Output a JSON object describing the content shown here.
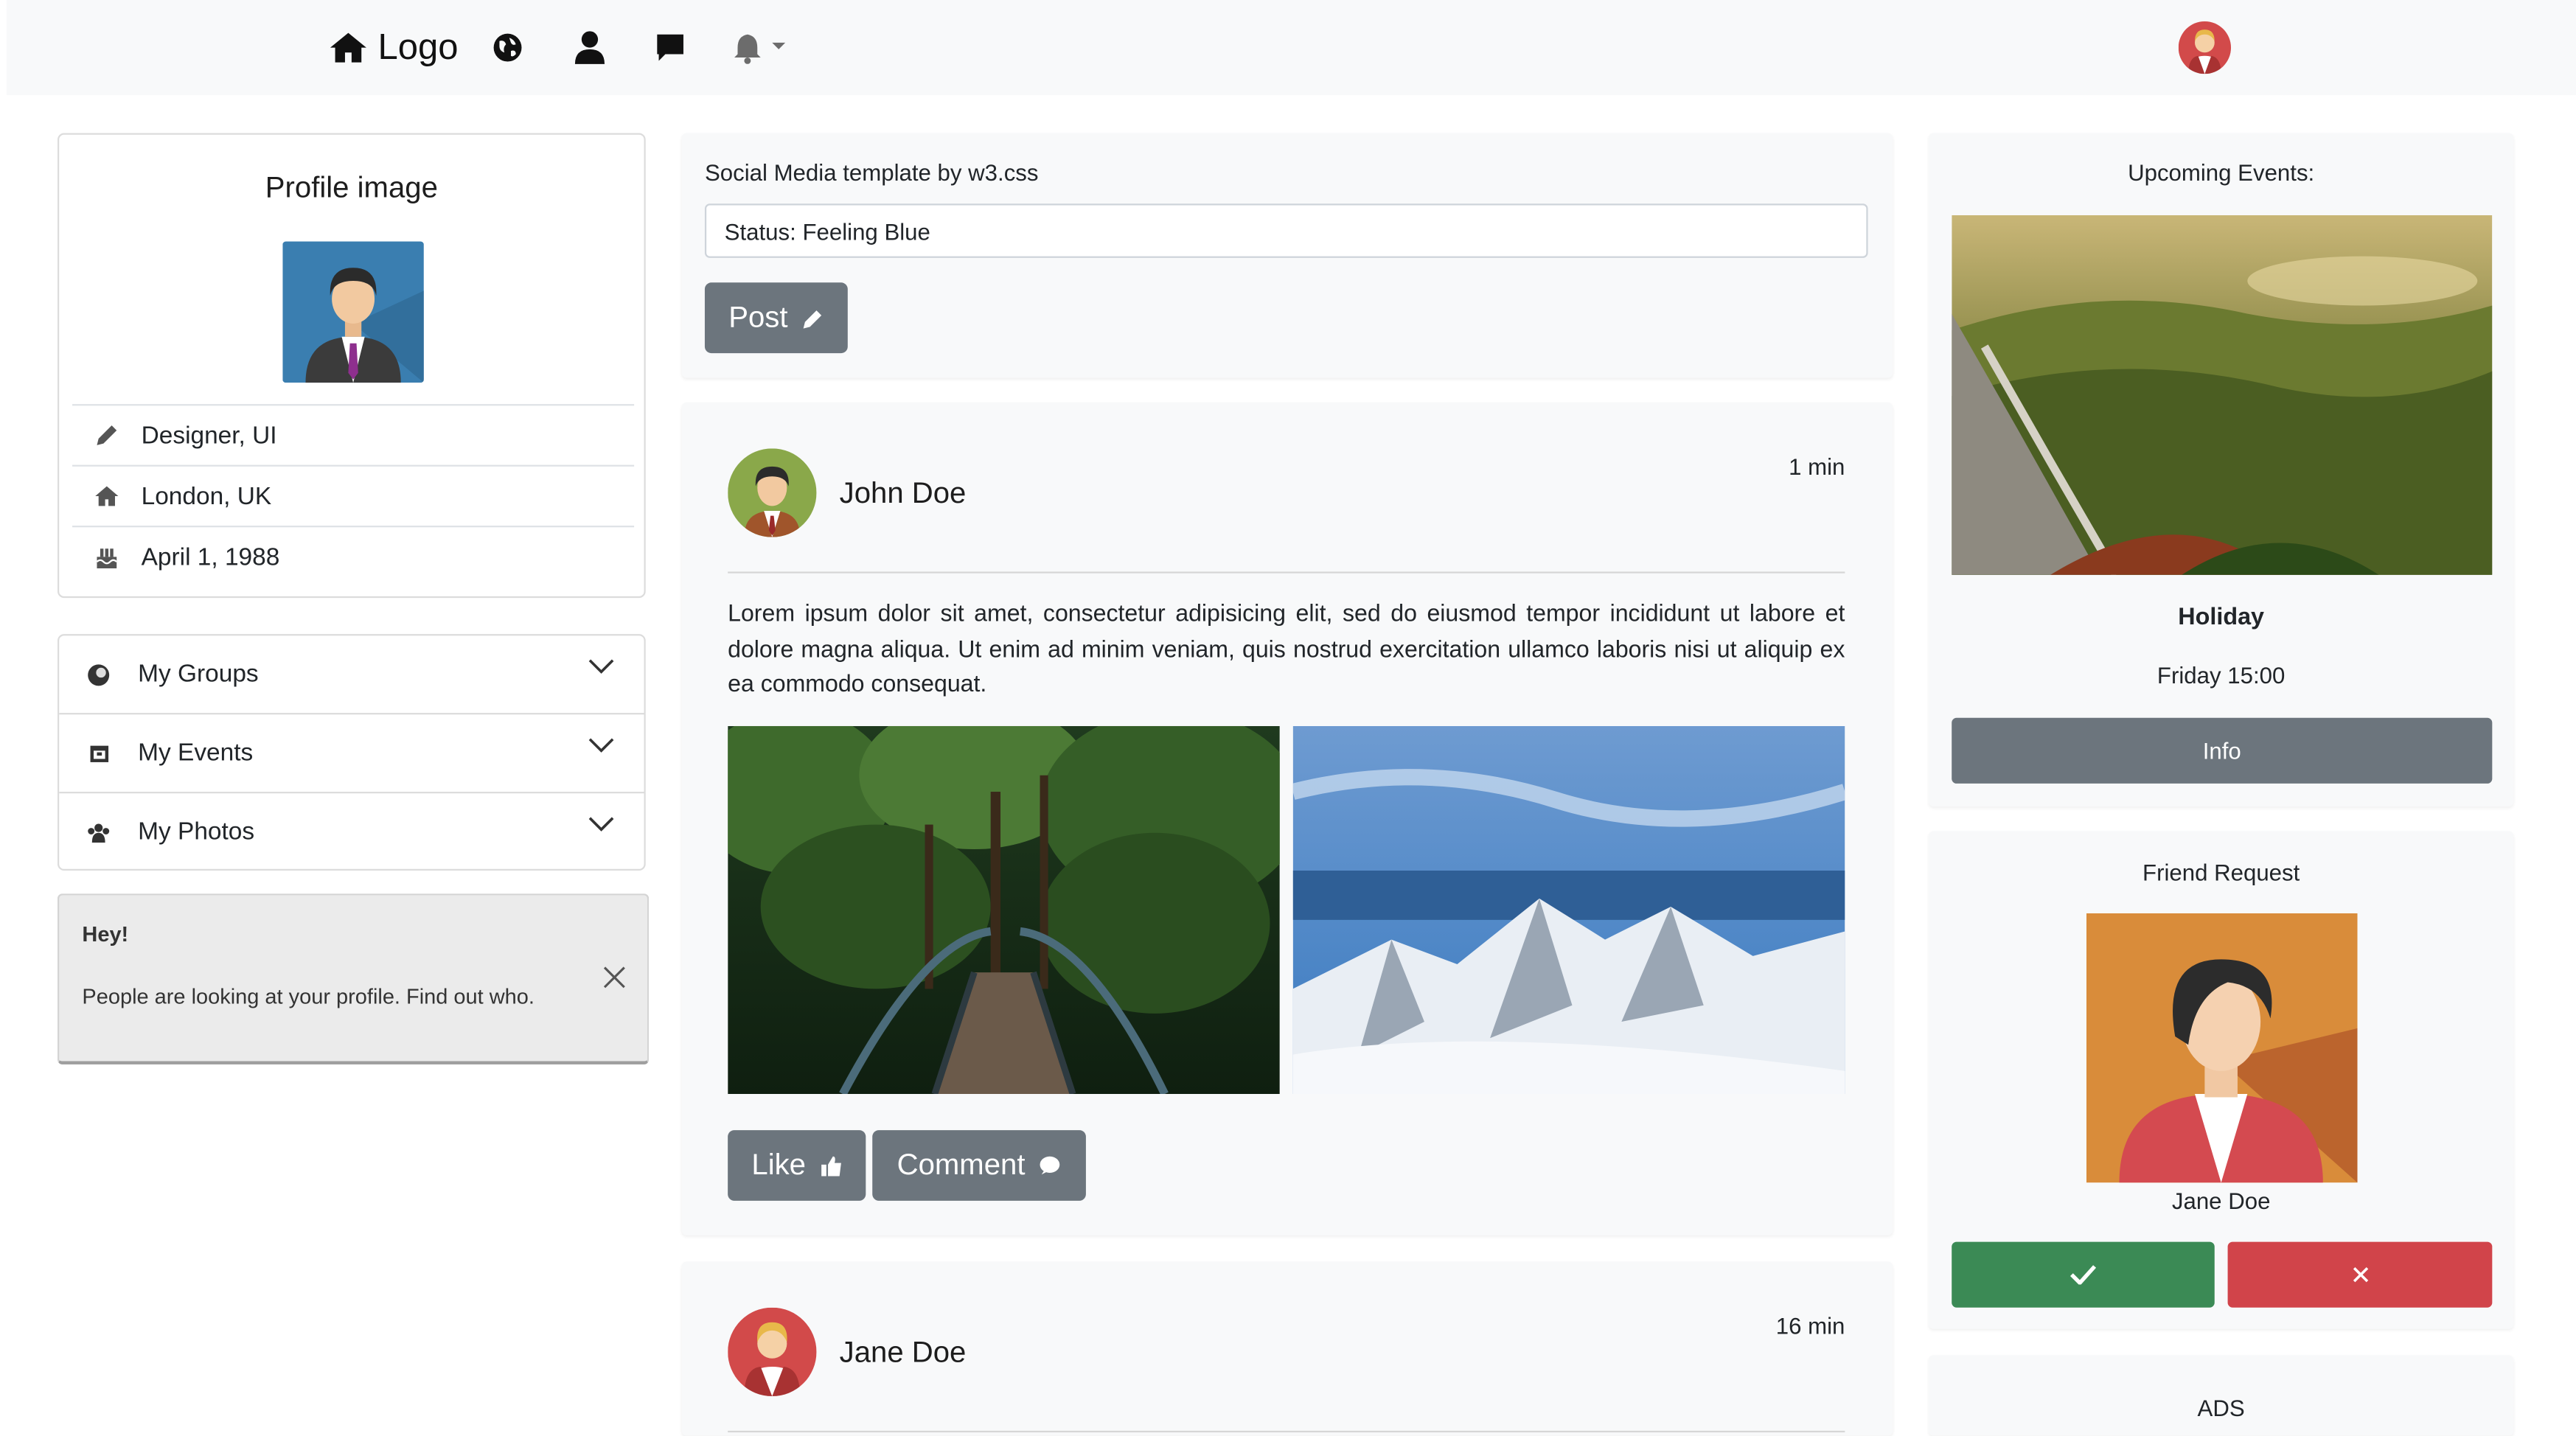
{
  "nav": {
    "logo_label": "Logo",
    "icons": [
      "home-icon",
      "globe-icon",
      "user-icon",
      "message-icon",
      "bell-icon"
    ]
  },
  "profile": {
    "title": "Profile image",
    "job": "Designer, UI",
    "location": "London, UK",
    "birthday": "April 1, 1988"
  },
  "accordion": [
    {
      "label": "My Groups",
      "icon": "circle-icon"
    },
    {
      "label": "My Events",
      "icon": "calendar-icon"
    },
    {
      "label": "My Photos",
      "icon": "users-icon"
    }
  ],
  "alert": {
    "title": "Hey!",
    "text": "People are looking at your profile. Find out who."
  },
  "composer": {
    "heading": "Social Media template by w3.css",
    "status_value": "Status: Feeling Blue",
    "post_label": "Post"
  },
  "posts": [
    {
      "author": "John Doe",
      "time": "1 min",
      "text": "Lorem ipsum dolor sit amet, consectetur adipisicing elit, sed do eiusmod tempor incididunt ut labore et dolore magna aliqua. Ut enim ad minim veniam, quis nostrud exercitation ullamco laboris nisi ut aliquip ex ea commodo consequat.",
      "like_label": "Like",
      "comment_label": "Comment"
    },
    {
      "author": "Jane Doe",
      "time": "16 min"
    }
  ],
  "events": {
    "title": "Upcoming Events:",
    "name": "Holiday",
    "when": "Friday 15:00",
    "info_label": "Info"
  },
  "friend_request": {
    "title": "Friend Request",
    "name": "Jane Doe",
    "accept_icon": "check-icon",
    "decline_icon": "close-icon"
  },
  "ads": {
    "title": "ADS"
  },
  "colors": {
    "button_grey": "#6c757d",
    "accept_green": "#3b8a55",
    "decline_red": "#d1444a",
    "card_bg": "#f8f9fa"
  }
}
